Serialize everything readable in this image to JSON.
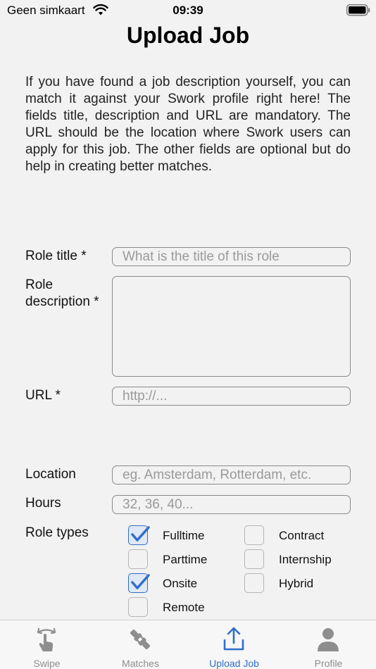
{
  "status_bar": {
    "carrier": "Geen simkaart",
    "time": "09:39"
  },
  "page_title": "Upload Job",
  "intro_text": "If you have found a job description yourself, you can match it against your Swork profile right here! The fields title, description and URL are mandatory. The URL should be the location where Swork users can apply for this job. The other fields are optional but do help in creating better matches.",
  "form": {
    "role_title": {
      "label": "Role title *",
      "placeholder": "What is the title of this role",
      "value": ""
    },
    "role_description": {
      "label": "Role description *",
      "value": ""
    },
    "url": {
      "label": "URL *",
      "placeholder": "http://...",
      "value": ""
    },
    "location": {
      "label": "Location",
      "placeholder": "eg. Amsterdam, Rotterdam, etc.",
      "value": ""
    },
    "hours": {
      "label": "Hours",
      "placeholder": "32, 36, 40...",
      "value": ""
    },
    "role_types": {
      "label": "Role types",
      "options": [
        {
          "label": "Fulltime",
          "checked": true
        },
        {
          "label": "Contract",
          "checked": false
        },
        {
          "label": "Parttime",
          "checked": false
        },
        {
          "label": "Internship",
          "checked": false
        },
        {
          "label": "Onsite",
          "checked": true
        },
        {
          "label": "Hybrid",
          "checked": false
        },
        {
          "label": "Remote",
          "checked": false
        }
      ]
    }
  },
  "tab_bar": {
    "active": "Upload Job",
    "items": [
      {
        "label": "Swipe",
        "icon": "swipe-hand-icon"
      },
      {
        "label": "Matches",
        "icon": "plug-icon"
      },
      {
        "label": "Upload Job",
        "icon": "upload-icon"
      },
      {
        "label": "Profile",
        "icon": "person-icon"
      }
    ]
  },
  "colors": {
    "accent": "#2f6fc8",
    "background": "#f2f2f2",
    "inactive_tab": "#8e8e8e"
  }
}
